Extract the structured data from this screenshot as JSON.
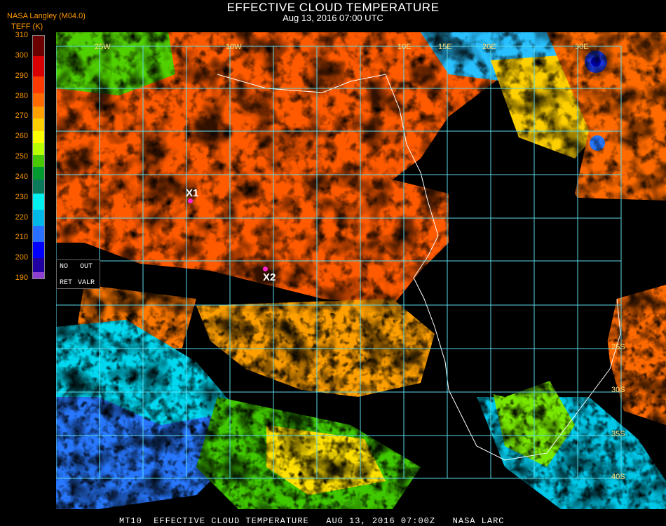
{
  "header": {
    "title": "EFFECTIVE CLOUD TEMPERATURE",
    "subtitle": "Aug 13, 2016 07:00 UTC",
    "source": "NASA Langley (M04.0)",
    "units": "TEFF (K)"
  },
  "colorbar": {
    "ticks": [
      "310",
      "300",
      "290",
      "280",
      "270",
      "260",
      "250",
      "240",
      "230",
      "220",
      "210",
      "200",
      "190"
    ],
    "segments": [
      {
        "value": 305,
        "color": "#6a0000"
      },
      {
        "value": 295,
        "color": "#d80000"
      },
      {
        "value": 285,
        "color": "#ff3a00"
      },
      {
        "value": 278,
        "color": "#ff6a00"
      },
      {
        "value": 272,
        "color": "#ffa000"
      },
      {
        "value": 266,
        "color": "#ffd000"
      },
      {
        "value": 260,
        "color": "#ffff00"
      },
      {
        "value": 254,
        "color": "#b8ff00"
      },
      {
        "value": 248,
        "color": "#48c800"
      },
      {
        "value": 242,
        "color": "#009a30"
      },
      {
        "value": 236,
        "color": "#0a7a5a"
      },
      {
        "value": 228,
        "color": "#00f0f0"
      },
      {
        "value": 220,
        "color": "#00b8e8"
      },
      {
        "value": 212,
        "color": "#2870ff"
      },
      {
        "value": 204,
        "color": "#0000ff"
      },
      {
        "value": 196,
        "color": "#2000a0"
      },
      {
        "value": 190,
        "color": "#9040d0"
      }
    ]
  },
  "map": {
    "grid_color": "#5ad8e8",
    "top_labels": [
      "25W",
      "10W",
      "10E",
      "15E",
      "20E",
      "30E"
    ],
    "right_labels": [
      "25S",
      "30S",
      "35S",
      "40S"
    ]
  },
  "overlay": {
    "no": "NO",
    "out": "OUT",
    "ret": "RET",
    "valr": "VALR"
  },
  "markers": [
    {
      "label": "X1",
      "color": "#ff22cc"
    },
    {
      "label": "X2",
      "color": "#ff22cc"
    }
  ],
  "footer": "MT10  EFFECTIVE CLOUD TEMPERATURE   AUG 13, 2016 07:00Z   NASA LARC"
}
